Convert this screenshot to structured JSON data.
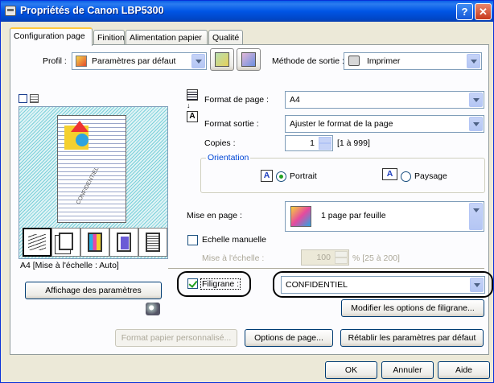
{
  "window": {
    "title": "Propriétés de Canon LBP5300",
    "help": "?",
    "close": "✕"
  },
  "tabs": [
    "Configuration page",
    "Finition",
    "Alimentation papier",
    "Qualité"
  ],
  "profil": {
    "label": "Profil :",
    "value": "Paramètres par défaut"
  },
  "methode": {
    "label": "Méthode de sortie :",
    "value": "Imprimer"
  },
  "page": {
    "format_label": "Format de page :",
    "format_value": "A4",
    "sortie_label": "Format sortie :",
    "sortie_value": "Ajuster le format de la page",
    "copies_label": "Copies :",
    "copies_value": "1",
    "copies_range": "[1 à 999]"
  },
  "orientation": {
    "label": "Orientation",
    "portrait": "Portrait",
    "paysage": "Paysage",
    "icon_letter": "A"
  },
  "mise_en_page": {
    "label": "Mise en page :",
    "value": "1 page par feuille"
  },
  "echelle": {
    "label": "Echelle manuelle",
    "mise_label": "Mise à l'échelle :",
    "value": "100",
    "range": "% [25 à 200]"
  },
  "preview": {
    "caption": "A4 [Mise à l'échelle : Auto]",
    "watermark_text": "CONFIDENTIEL",
    "button": "Affichage des paramètres"
  },
  "filigrane": {
    "label": "Filigrane :",
    "value": "CONFIDENTIEL",
    "modify_button": "Modifier les options de filigrane..."
  },
  "footer_buttons": {
    "custom": "Format papier personnalisé...",
    "options": "Options de page...",
    "reset": "Rétablir les paramètres par défaut"
  },
  "dialog_buttons": {
    "ok": "OK",
    "cancel": "Annuler",
    "help": "Aide"
  },
  "colors": {
    "accent": "#0055e5",
    "highlight_border": "#000000",
    "check_green": "#21a121"
  }
}
